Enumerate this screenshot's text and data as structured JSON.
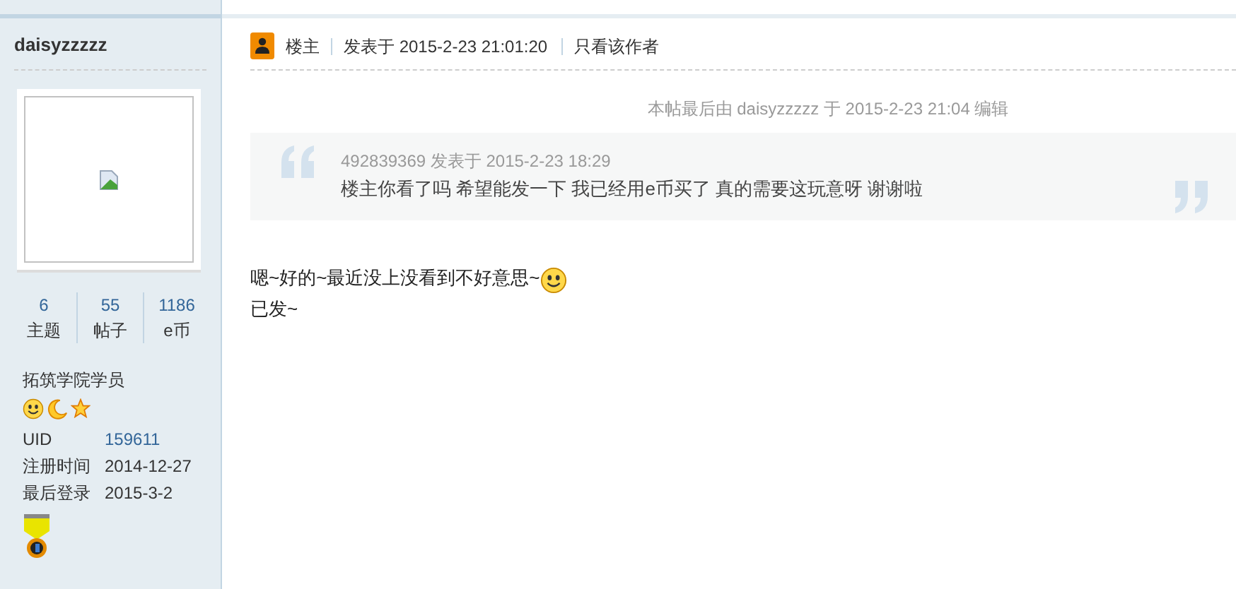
{
  "author": {
    "name": "daisyzzzzz",
    "stats": [
      {
        "value": "6",
        "label": "主题"
      },
      {
        "value": "55",
        "label": "帖子"
      },
      {
        "value": "1186",
        "label": "e币"
      }
    ],
    "group": "拓筑学院学员",
    "profile": [
      {
        "label": "UID",
        "value": "159611",
        "link": true
      },
      {
        "label": "注册时间",
        "value": "2014-12-27",
        "link": false
      },
      {
        "label": "最后登录",
        "value": "2015-3-2",
        "link": false
      }
    ]
  },
  "post": {
    "floor": "楼主",
    "posted": "发表于 2015-2-23 21:01:20",
    "only_author": "只看该作者",
    "edit_note": "本帖最后由 daisyzzzzz 于 2015-2-23 21:04 编辑",
    "quote": {
      "header": "492839369 发表于 2015-2-23 18:29",
      "text": "楼主你看了吗 希望能发一下  我已经用e币买了 真的需要这玩意呀  谢谢啦"
    },
    "body": [
      "嗯~好的~最近没上没看到不好意思~",
      "已发~"
    ]
  }
}
